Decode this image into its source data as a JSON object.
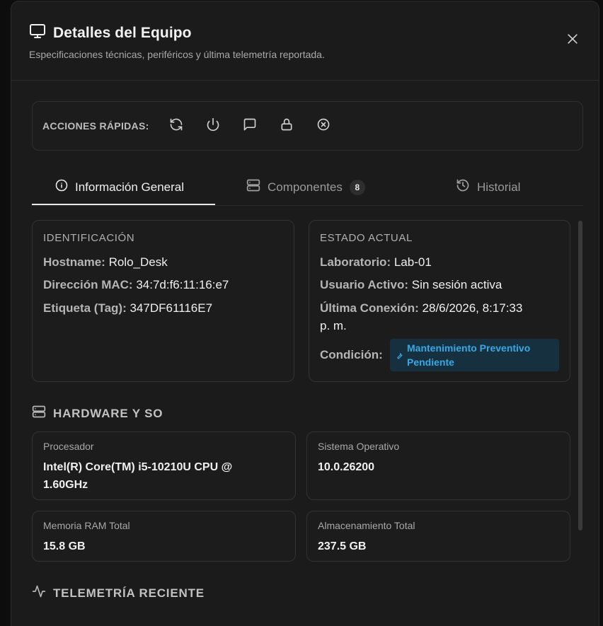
{
  "modal": {
    "title": "Detalles del Equipo",
    "subtitle": "Especificaciones técnicas, periféricos y última telemetría reportada.",
    "title_icon": "monitor-icon",
    "close_icon": "close-icon"
  },
  "quick_actions": {
    "label": "ACCIONES RÁPIDAS:",
    "icons": [
      "refresh-icon",
      "power-icon",
      "message-icon",
      "lock-icon",
      "close-circle-icon"
    ]
  },
  "tabs": [
    {
      "label": "Información General",
      "icon": "info-icon",
      "active": true
    },
    {
      "label": "Componentes",
      "icon": "server-icon",
      "badge": "8",
      "active": false
    },
    {
      "label": "Historial",
      "icon": "history-icon",
      "active": false
    }
  ],
  "identificacion": {
    "title": "IDENTIFICACIÓN",
    "hostname_label": "Hostname:",
    "hostname": "Rolo_Desk",
    "mac_label": "Dirección MAC:",
    "mac": "34:7d:f6:11:16:e7",
    "tag_label": "Etiqueta (Tag):",
    "tag": "347DF61116E7"
  },
  "estado": {
    "title": "ESTADO ACTUAL",
    "lab_label": "Laboratorio:",
    "lab": "Lab-01",
    "user_label": "Usuario Activo:",
    "user": "Sin sesión activa",
    "last_label": "Última Conexión:",
    "last": "28/6/2026, 8:17:33",
    "last_suffix": "p. m.",
    "cond_label": "Condición:",
    "cond_line1": "Mantenimiento Preventivo",
    "cond_line2": "Pendiente",
    "cond_color": "#37a8e6"
  },
  "hardware": {
    "title": "HARDWARE Y SO",
    "cpu_label": "Procesador",
    "cpu_line1": "Intel(R) Core(TM) i5-10210U CPU @",
    "cpu_line2": "1.60GHz",
    "os_label": "Sistema Operativo",
    "os": "10.0.26200",
    "ram_label": "Memoria RAM Total",
    "ram": "15.8 GB",
    "storage_label": "Almacenamiento Total",
    "storage": "237.5 GB"
  },
  "telemetry": {
    "title": "TELEMETRÍA RECIENTE"
  }
}
